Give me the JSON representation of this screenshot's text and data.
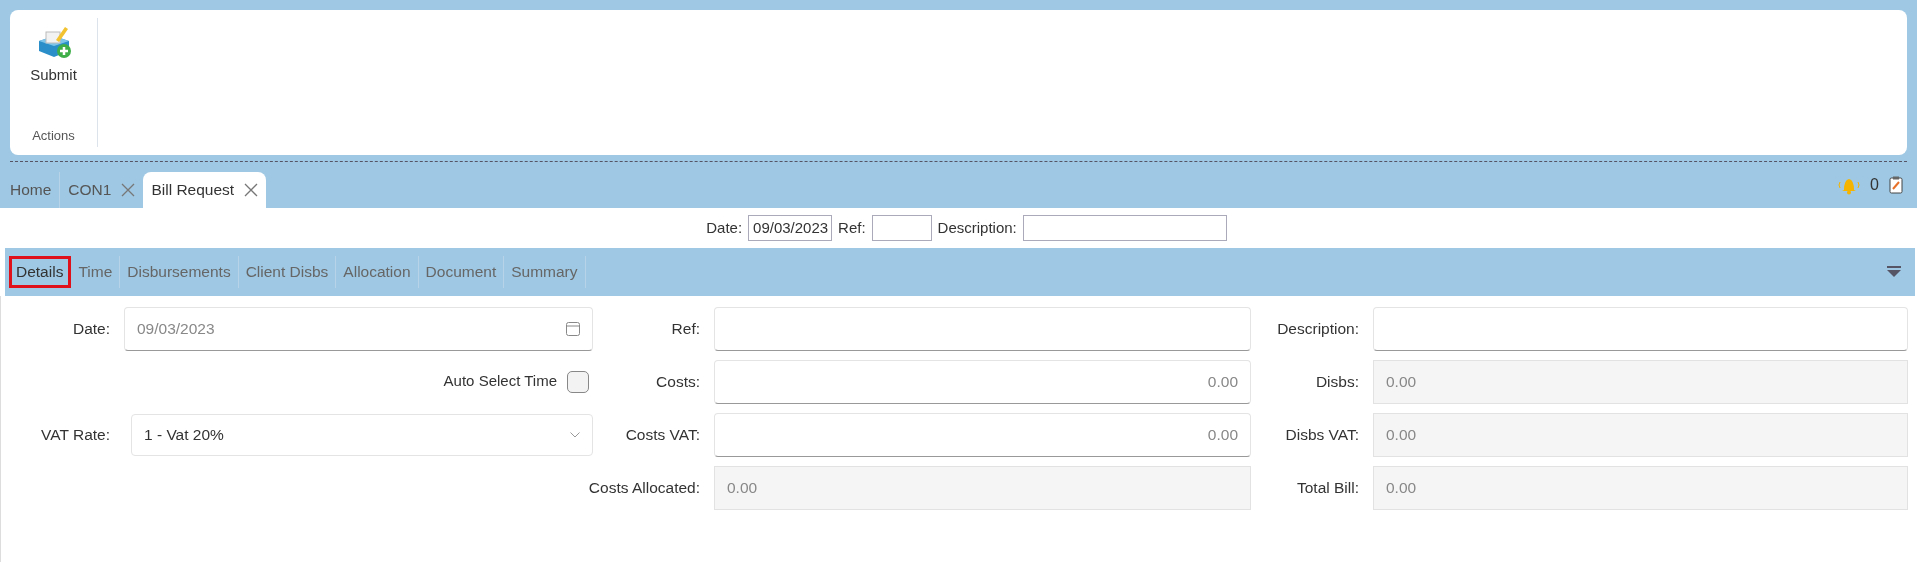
{
  "ribbon": {
    "groups": [
      {
        "label": "Actions",
        "buttons": [
          {
            "label": "Submit"
          }
        ]
      }
    ]
  },
  "doc_tabs": [
    {
      "label": "Home",
      "closable": false,
      "selected": false
    },
    {
      "label": "CON1",
      "closable": true,
      "selected": false
    },
    {
      "label": "Bill Request",
      "closable": true,
      "selected": true
    }
  ],
  "notifications": {
    "count": "0"
  },
  "header_fields": [
    {
      "label": "Date:",
      "value": "09/03/2023",
      "kind": "short"
    },
    {
      "label": "Ref:",
      "kind": "tiny"
    },
    {
      "label": "Description:",
      "kind": "wide"
    }
  ],
  "section_tabs": [
    {
      "label": "Details",
      "selected": true
    },
    {
      "label": "Time",
      "selected": false
    },
    {
      "label": "Disbursements",
      "selected": false
    },
    {
      "label": "Client Disbs",
      "selected": false
    },
    {
      "label": "Allocation",
      "selected": false
    },
    {
      "label": "Document",
      "selected": false
    },
    {
      "label": "Summary",
      "selected": false
    }
  ],
  "form": {
    "rows": [
      [
        {
          "kind": "date",
          "label": "Date:",
          "value": "09/03/2023"
        },
        {
          "kind": "text",
          "label": "Ref:"
        },
        {
          "kind": "text",
          "label": "Description:"
        }
      ],
      [
        {
          "kind": "checkbox",
          "label": "Auto Select Time",
          "checked": false
        },
        {
          "kind": "number",
          "label": "Costs:",
          "value": "0.00"
        },
        {
          "kind": "readonly",
          "label": "Disbs:",
          "value": "0.00"
        }
      ],
      [
        {
          "kind": "select",
          "label": "VAT Rate:",
          "value": "1 - Vat 20%"
        },
        {
          "kind": "number",
          "label": "Costs VAT:",
          "value": "0.00"
        },
        {
          "kind": "readonly",
          "label": "Disbs VAT:",
          "value": "0.00"
        }
      ],
      [
        {
          "kind": "empty"
        },
        {
          "kind": "readonly",
          "label": "Costs Allocated:",
          "value": "0.00"
        },
        {
          "kind": "readonly",
          "label": "Total Bill:",
          "value": "0.00"
        }
      ]
    ]
  }
}
